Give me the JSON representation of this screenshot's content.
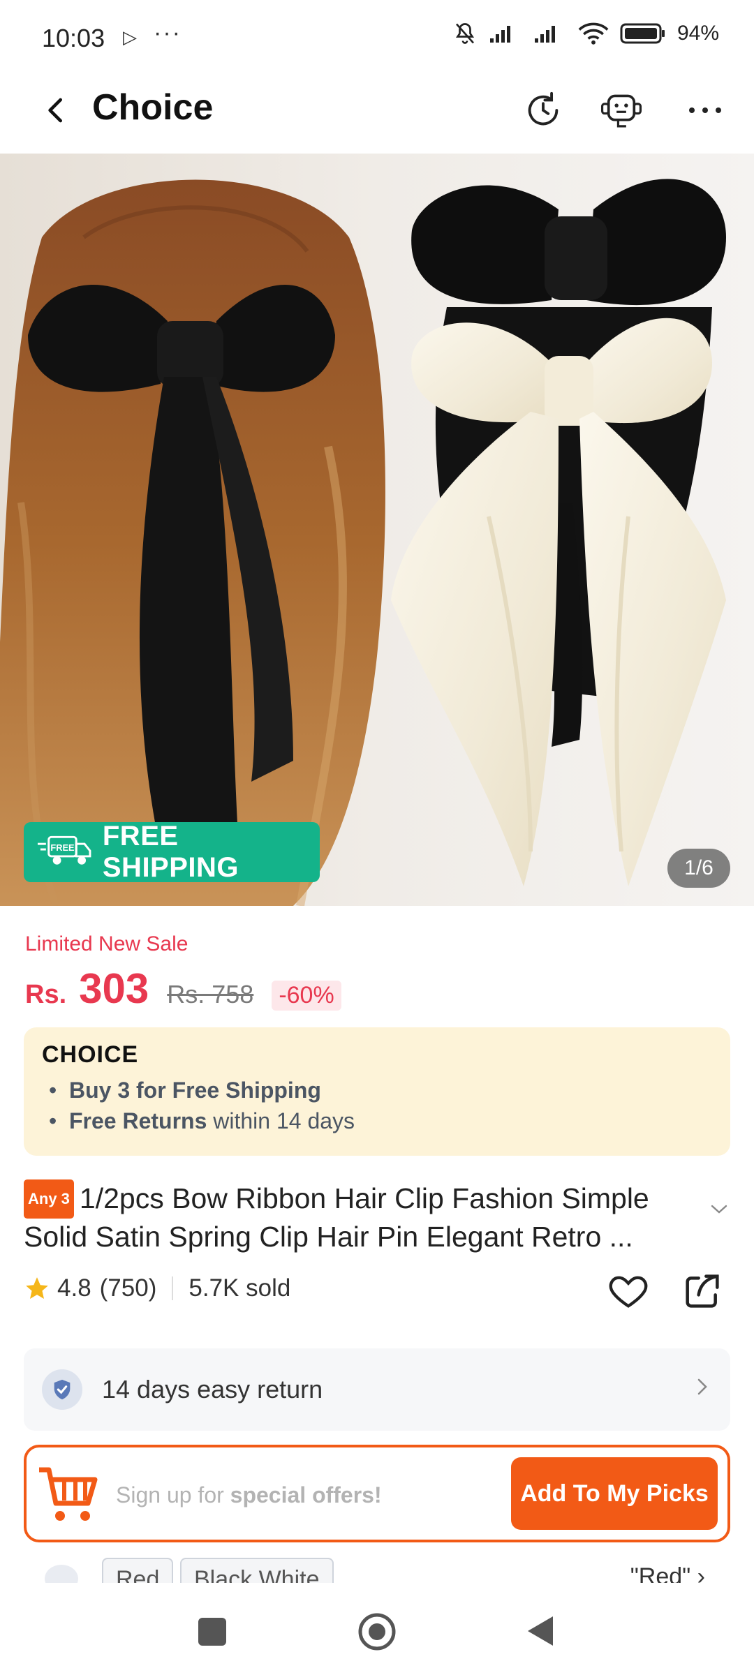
{
  "status_bar": {
    "time": "10:03",
    "battery": "94%"
  },
  "header": {
    "title": "Choice",
    "icons": [
      "back-icon",
      "refresh-icon",
      "support-bot-icon",
      "more-icon"
    ]
  },
  "hero": {
    "free_shipping_badge": "FREE SHIPPING",
    "free_badge_small": "FREE",
    "image_counter": "1/6"
  },
  "price": {
    "sale_label": "Limited New Sale",
    "currency": "Rs.",
    "current": "303",
    "original": "Rs. 758",
    "discount": "-60%"
  },
  "choice_card": {
    "logo": "CHOICE",
    "line1_bold": "Buy 3 for  Free Shipping",
    "line2_bold": "Free Returns",
    "line2_rest": " within 14 days"
  },
  "product": {
    "tag": "Any 3",
    "title": "1/2pcs Bow Ribbon Hair Clip Fashion Simple Solid Satin Spring Clip Hair Pin Elegant Retro ...",
    "rating": "4.8",
    "reviews": "(750)",
    "sold": "5.7K sold"
  },
  "return_policy": {
    "text": "14 days easy return"
  },
  "signup": {
    "text_pre": "Sign up for ",
    "text_bold": "special offers!",
    "button": "Add To My Picks"
  },
  "variants": {
    "options": [
      "Red",
      "Black White"
    ],
    "selected": "\"Red\""
  },
  "colors": {
    "accent_orange": "#f25a16",
    "price_red": "#e8384f",
    "free_ship_green": "#14b38a",
    "choice_card_bg": "#fdf3d8"
  }
}
